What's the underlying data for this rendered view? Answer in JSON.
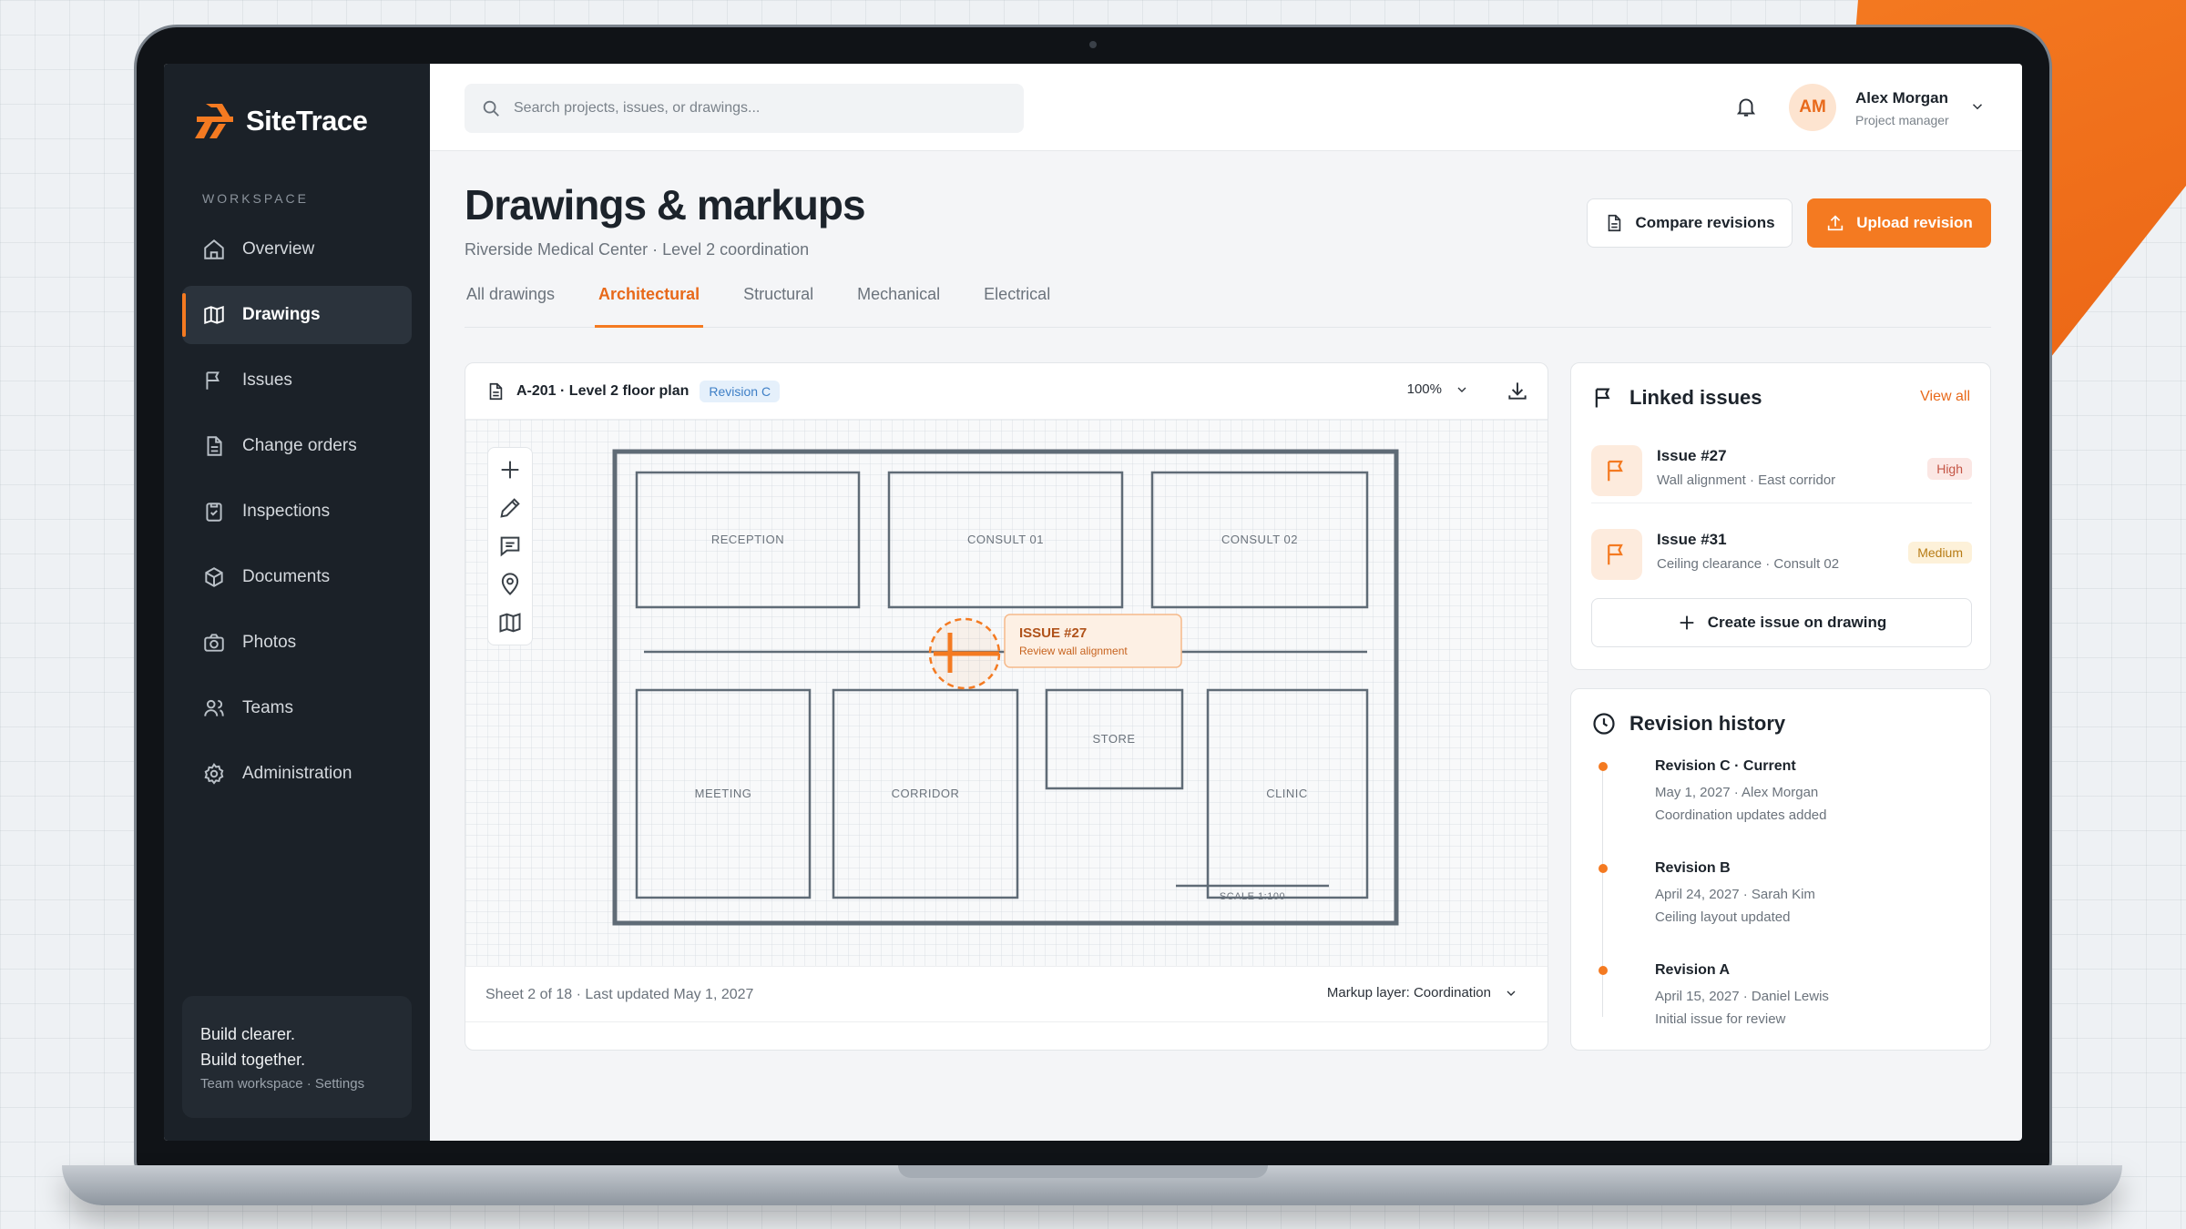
{
  "app": {
    "name": "SiteTrace"
  },
  "sidebar": {
    "section_label": "WORKSPACE",
    "items": [
      {
        "label": "Overview",
        "icon": "home-icon",
        "active": false
      },
      {
        "label": "Drawings",
        "icon": "map-icon",
        "active": true
      },
      {
        "label": "Issues",
        "icon": "flag-icon",
        "active": false
      },
      {
        "label": "Change orders",
        "icon": "document-icon",
        "active": false
      },
      {
        "label": "Inspections",
        "icon": "clipboard-check-icon",
        "active": false
      },
      {
        "label": "Documents",
        "icon": "box-icon",
        "active": false
      },
      {
        "label": "Photos",
        "icon": "camera-icon",
        "active": false
      },
      {
        "label": "Teams",
        "icon": "users-icon",
        "active": false
      },
      {
        "label": "Administration",
        "icon": "gear-icon",
        "active": false
      }
    ],
    "promo": {
      "line1": "Build clearer.",
      "line2": "Build together.",
      "sub": "Team workspace · Settings"
    }
  },
  "topbar": {
    "search_placeholder": "Search projects, issues, or drawings...",
    "user": {
      "initials": "AM",
      "name": "Alex Morgan",
      "role": "Project manager"
    }
  },
  "page": {
    "title": "Drawings & markups",
    "subtitle": "Riverside Medical Center · Level 2 coordination",
    "compare_label": "Compare revisions",
    "upload_label": "Upload revision",
    "tabs": [
      {
        "label": "All drawings",
        "active": false
      },
      {
        "label": "Architectural",
        "active": true
      },
      {
        "label": "Structural",
        "active": false
      },
      {
        "label": "Mechanical",
        "active": false
      },
      {
        "label": "Electrical",
        "active": false
      }
    ]
  },
  "drawing": {
    "title": "A-201 · Level 2 floor plan",
    "revision_badge": "Revision C",
    "zoom": "100%",
    "rooms": [
      "RECEPTION",
      "CONSULT 01",
      "CONSULT 02",
      "MEETING",
      "CORRIDOR",
      "STORE",
      "CLINIC"
    ],
    "scale": "SCALE 1:100",
    "markup": {
      "title": "ISSUE #27",
      "note": "Review wall alignment"
    },
    "sheet_info": "Sheet 2 of 18 · Last updated May 1, 2027",
    "markup_layer": "Markup layer: Coordination"
  },
  "linked_issues": {
    "title": "Linked issues",
    "view_all": "View all",
    "items": [
      {
        "name": "Issue #27",
        "desc": "Wall alignment · East corridor",
        "priority": "High"
      },
      {
        "name": "Issue #31",
        "desc": "Ceiling clearance · Consult 02",
        "priority": "Medium"
      }
    ],
    "create_label": "Create issue on drawing"
  },
  "revision_history": {
    "title": "Revision history",
    "items": [
      {
        "name": "Revision C · Current",
        "meta": "May 1, 2027 · Alex Morgan",
        "note": "Coordination updates added"
      },
      {
        "name": "Revision B",
        "meta": "April 24, 2027 · Sarah Kim",
        "note": "Ceiling layout updated"
      },
      {
        "name": "Revision A",
        "meta": "April 15, 2027 · Daniel Lewis",
        "note": "Initial issue for review"
      }
    ]
  },
  "colors": {
    "accent": "#f47a21",
    "sidebar_bg": "#1b2128",
    "plan_wall": "#5f6b76"
  }
}
